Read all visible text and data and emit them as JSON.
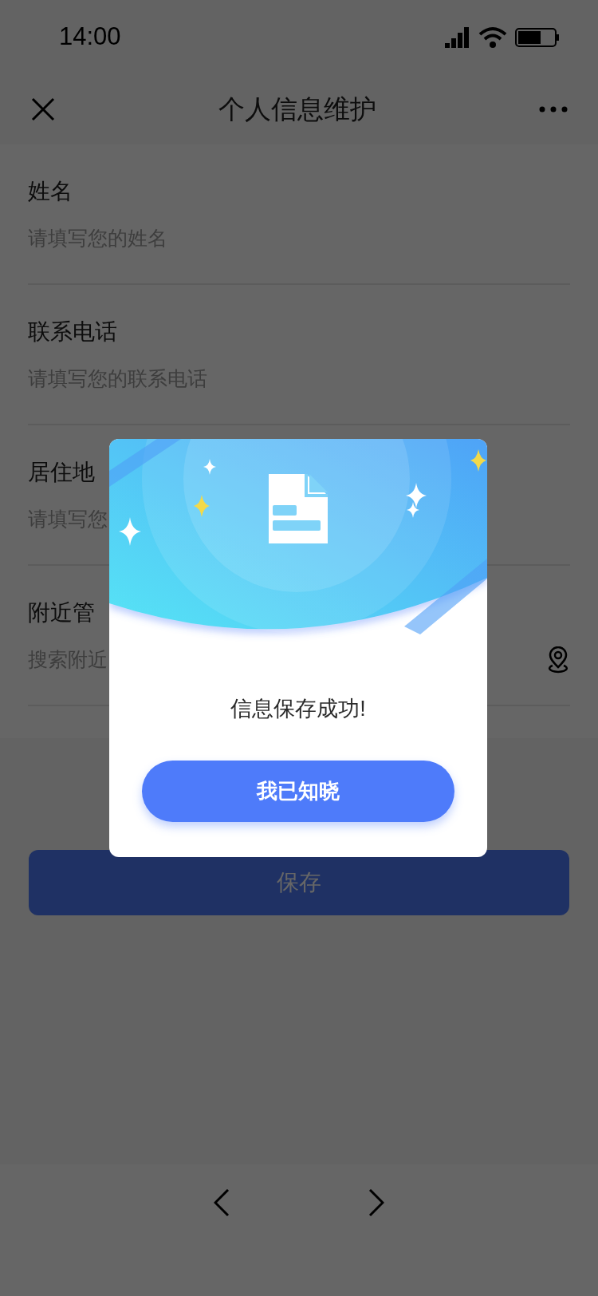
{
  "status_bar": {
    "time": "14:00"
  },
  "nav": {
    "title": "个人信息维护"
  },
  "fields": [
    {
      "label": "姓名",
      "placeholder": "请填写您的姓名",
      "kind": "text"
    },
    {
      "label": "联系电话",
      "placeholder": "请填写您的联系电话",
      "kind": "text"
    },
    {
      "label": "居住地",
      "placeholder": "请填写您",
      "kind": "text"
    },
    {
      "label": "附近管",
      "placeholder": "搜索附近",
      "kind": "location"
    }
  ],
  "save_button": {
    "label": "保存"
  },
  "dialog": {
    "message": "信息保存成功!",
    "button": "我已知晓"
  }
}
